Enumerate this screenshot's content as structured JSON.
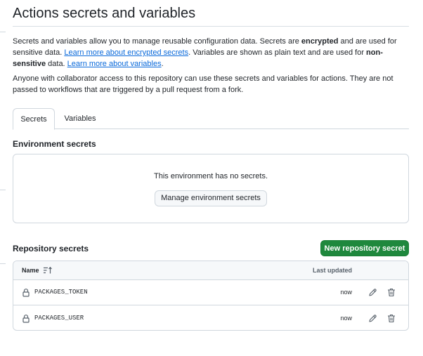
{
  "page": {
    "title": "Actions secrets and variables",
    "intro": {
      "t1": "Secrets and variables allow you to manage reusable configuration data. Secrets are ",
      "b1": "encrypted",
      "t2": " and are used for sensitive data. ",
      "link1": "Learn more about encrypted secrets",
      "t3": ". Variables are shown as plain text and are used for ",
      "b2": "non-sensitive",
      "t4": " data. ",
      "link2": "Learn more about variables",
      "t5": "."
    },
    "note": "Anyone with collaborator access to this repository can use these secrets and variables for actions. They are not passed to workflows that are triggered by a pull request from a fork."
  },
  "tabs": [
    {
      "label": "Secrets",
      "active": true
    },
    {
      "label": "Variables",
      "active": false
    }
  ],
  "environment": {
    "title": "Environment secrets",
    "empty_text": "This environment has no secrets.",
    "manage_button": "Manage environment secrets"
  },
  "repository": {
    "title": "Repository secrets",
    "new_button": "New repository secret",
    "columns": {
      "name": "Name",
      "updated": "Last updated"
    },
    "rows": [
      {
        "name": "PACKAGES_TOKEN",
        "updated": "now"
      },
      {
        "name": "PACKAGES_USER",
        "updated": "now"
      }
    ]
  },
  "icons": {
    "sort": "sort-icon",
    "lock": "lock-icon",
    "edit": "pencil-icon",
    "delete": "trash-icon"
  },
  "colors": {
    "link": "#0969da",
    "primary_button": "#1f883d",
    "border": "#d0d7de"
  }
}
